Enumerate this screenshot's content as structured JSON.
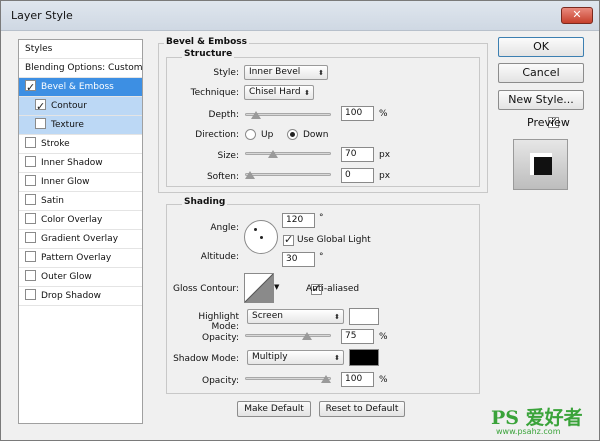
{
  "window": {
    "title": "Layer Style",
    "close_glyph": "✕"
  },
  "left_panel": {
    "header": "Styles",
    "blending": "Blending Options: Custom",
    "items": [
      {
        "label": "Bevel & Emboss",
        "checked": true,
        "state": "selected"
      },
      {
        "label": "Contour",
        "checked": true,
        "state": "sub"
      },
      {
        "label": "Texture",
        "checked": false,
        "state": "sub"
      },
      {
        "label": "Stroke",
        "checked": false
      },
      {
        "label": "Inner Shadow",
        "checked": false
      },
      {
        "label": "Inner Glow",
        "checked": false
      },
      {
        "label": "Satin",
        "checked": false
      },
      {
        "label": "Color Overlay",
        "checked": false
      },
      {
        "label": "Gradient Overlay",
        "checked": false
      },
      {
        "label": "Pattern Overlay",
        "checked": false
      },
      {
        "label": "Outer Glow",
        "checked": false
      },
      {
        "label": "Drop Shadow",
        "checked": false
      }
    ]
  },
  "bevel": {
    "section_title": "Bevel & Emboss",
    "structure_title": "Structure",
    "style_label": "Style:",
    "style_value": "Inner Bevel",
    "technique_label": "Technique:",
    "technique_value": "Chisel Hard",
    "depth_label": "Depth:",
    "depth_value": "100",
    "depth_unit": "%",
    "depth_level_pct": 8,
    "direction_label": "Direction:",
    "direction_up": "Up",
    "direction_down": "Down",
    "direction_selected": "Down",
    "size_label": "Size:",
    "size_value": "70",
    "size_unit": "px",
    "size_level_pct": 30,
    "soften_label": "Soften:",
    "soften_value": "0",
    "soften_unit": "px",
    "soften_level_pct": 0
  },
  "shading": {
    "title": "Shading",
    "angle_label": "Angle:",
    "angle_value": "120",
    "angle_unit": "°",
    "use_global_light": "Use Global Light",
    "use_global_light_checked": true,
    "altitude_label": "Altitude:",
    "altitude_value": "30",
    "altitude_unit": "°",
    "gloss_label": "Gloss Contour:",
    "anti_aliased": "Anti-aliased",
    "anti_aliased_checked": true,
    "highlight_label": "Highlight Mode:",
    "highlight_value": "Screen",
    "highlight_color": "#ffffff",
    "highlight_opacity_label": "Opacity:",
    "highlight_opacity_value": "75",
    "highlight_opacity_unit": "%",
    "highlight_opacity_pct": 75,
    "shadow_label": "Shadow Mode:",
    "shadow_value": "Multiply",
    "shadow_color": "#000000",
    "shadow_opacity_label": "Opacity:",
    "shadow_opacity_value": "100",
    "shadow_opacity_unit": "%",
    "shadow_opacity_pct": 100
  },
  "footer": {
    "make_default": "Make Default",
    "reset_default": "Reset to Default"
  },
  "right": {
    "ok": "OK",
    "cancel": "Cancel",
    "new_style": "New Style...",
    "preview": "Preview",
    "preview_checked": true
  },
  "watermark": {
    "brand": "PS 爱好者",
    "url": "www.psahz.com"
  },
  "colors": {
    "selection": "#3d8fe3",
    "sub_selection": "#bcd8f5"
  }
}
